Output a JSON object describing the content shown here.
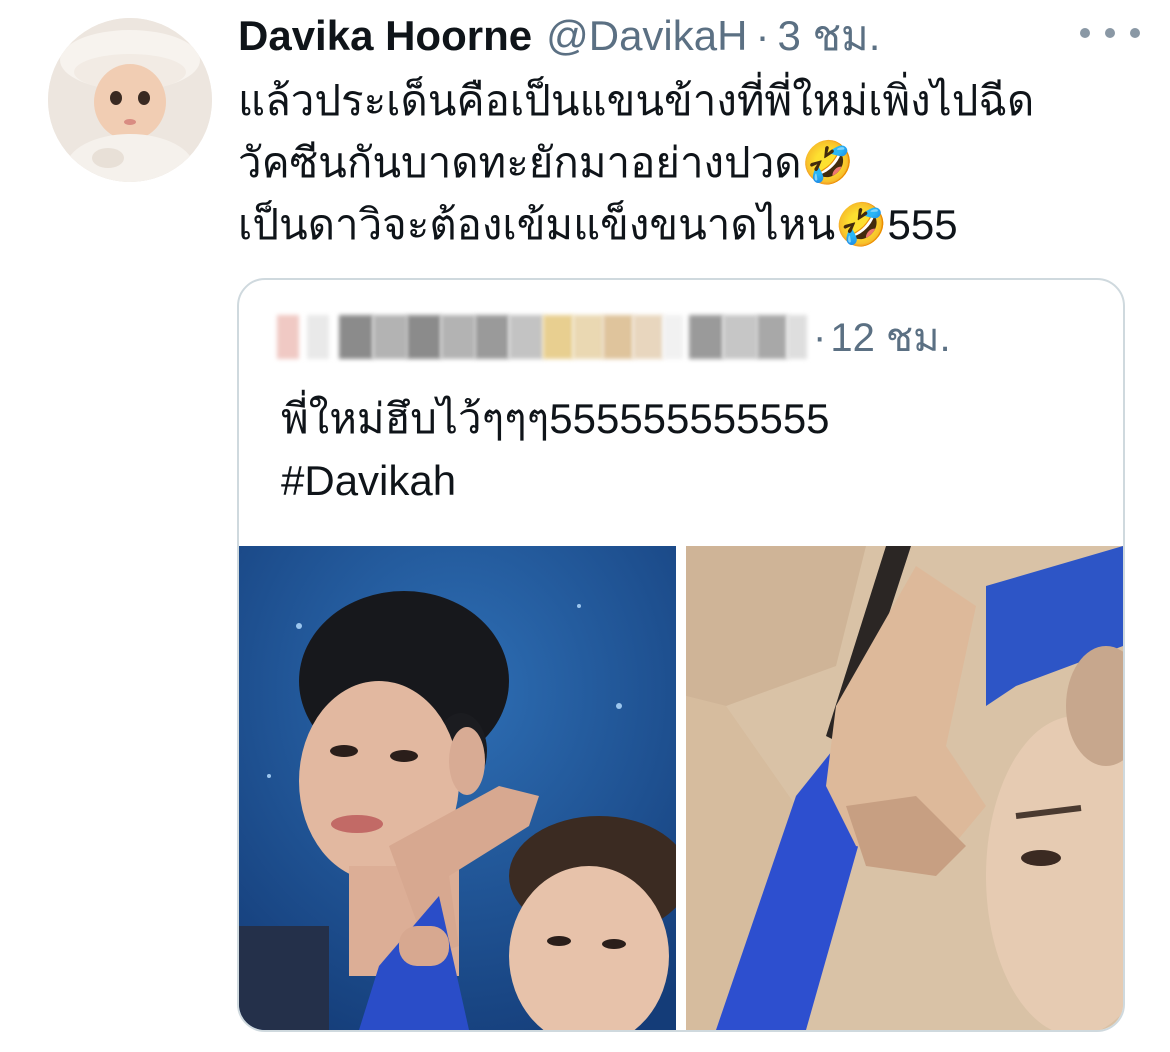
{
  "tweet": {
    "display_name": "Davika Hoorne",
    "handle": "@DavikaH",
    "separator": "·",
    "time": "3 ชม.",
    "text_lines": [
      "แล้วประเด็นคือเป็นแขนข้างที่พี่ใหม่เพิ่งไปฉีด",
      "วัคซีนกันบาดทะยักมาอย่างปวด🤣",
      "เป็นดาวิจะต้องเข้มแข็งขนาดไหน🤣555"
    ]
  },
  "quoted_tweet": {
    "separator": "·",
    "time": "12 ชม.",
    "text_lines": [
      "พี่ใหม่ฮึบไว้ๆๆๆ555555555555",
      "#Davikah"
    ]
  },
  "colors": {
    "text_primary": "#0f1419",
    "text_secondary": "#5b7083",
    "border": "#cfd9de"
  },
  "icons": {
    "more": "more-horizontal-icon"
  }
}
